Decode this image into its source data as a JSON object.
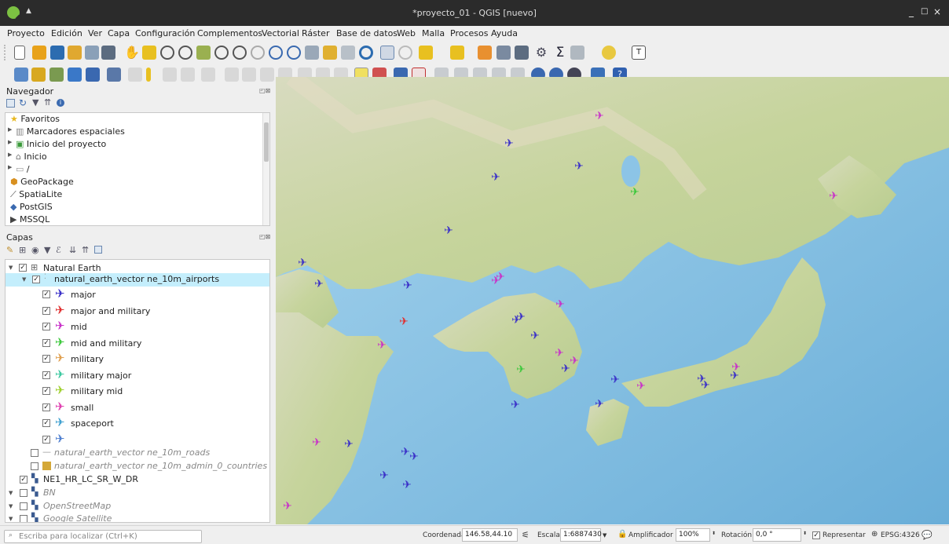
{
  "window": {
    "title": "*proyecto_01 - QGIS [nuevo]",
    "controls": [
      "_",
      "□",
      "×"
    ]
  },
  "menu": [
    "Proyecto",
    "Edición",
    "Ver",
    "Capa",
    "Configuración",
    "Complementos",
    "Vectorial",
    "Ráster",
    "Base de datos",
    "Web",
    "Malla",
    "Procesos",
    "Ayuda"
  ],
  "browser": {
    "title": "Navegador",
    "items": [
      {
        "label": "Favoritos",
        "icon": "star-icon"
      },
      {
        "label": "Marcadores espaciales",
        "icon": "bookmark-icon"
      },
      {
        "label": "Inicio del proyecto",
        "icon": "project-home-icon"
      },
      {
        "label": "Inicio",
        "icon": "home-folder-icon"
      },
      {
        "label": "/",
        "icon": "folder-icon"
      },
      {
        "label": "GeoPackage",
        "icon": "geopackage-icon"
      },
      {
        "label": "SpatiaLite",
        "icon": "spatialite-icon"
      },
      {
        "label": "PostGIS",
        "icon": "postgis-icon"
      },
      {
        "label": "MSSQL",
        "icon": "mssql-icon"
      }
    ]
  },
  "layers": {
    "title": "Capas",
    "group": "Natural Earth",
    "airports_layer": "natural_earth_vector ne_10m_airports",
    "categories": [
      {
        "label": "major",
        "color": "#3a30c8"
      },
      {
        "label": "major and military",
        "color": "#e03030"
      },
      {
        "label": "mid",
        "color": "#c832c8"
      },
      {
        "label": "mid and military",
        "color": "#3cc83c"
      },
      {
        "label": "military",
        "color": "#e0a050"
      },
      {
        "label": "military major",
        "color": "#3cc8a0"
      },
      {
        "label": "military mid",
        "color": "#a0d030"
      },
      {
        "label": "small",
        "color": "#e040b0"
      },
      {
        "label": "spaceport",
        "color": "#40a0d0"
      },
      {
        "label": "",
        "color": "#5080d0"
      }
    ],
    "roads_layer": "natural_earth_vector ne_10m_roads",
    "countries_layer": "natural_earth_vector ne_10m_admin_0_countries",
    "raster_layer": "NE1_HR_LC_SR_W_DR",
    "bn_layer": "BN",
    "osm_layer": "OpenStreetMap",
    "gsat_layer": "Google Satellite"
  },
  "status": {
    "locator_placeholder": "Escriba para localizar (Ctrl+K)",
    "coord_label": "Coordenada",
    "coord_value": "146.58,44.10",
    "scale_label": "Escala",
    "scale_value": "1:6887430",
    "magnifier_label": "Amplificador",
    "magnifier_value": "100%",
    "rotation_label": "Rotación",
    "rotation_value": "0,0 °",
    "render_label": "Representar",
    "crs": "EPSG:4326"
  },
  "colors": {
    "sea": "#8cc4e6",
    "land": "#c9d9a4",
    "titlebar": "#2b2b2b",
    "selection": "#c4eefc"
  }
}
